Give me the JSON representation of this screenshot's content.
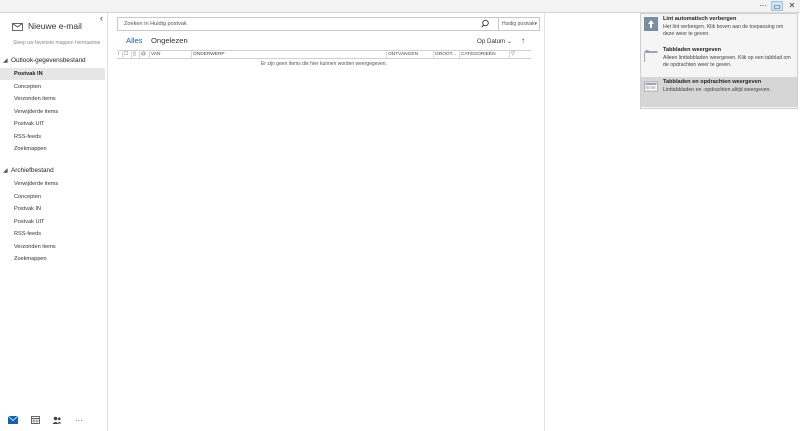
{
  "window": {
    "more_glyph": "···",
    "ribbon_options_glyph": "▭",
    "close_glyph": "✕"
  },
  "sidebar": {
    "new_mail_label": "Nieuwe e-mail",
    "collapse_glyph": "‹",
    "favorites_hint": "Sleep uw favoriete mappen hiernaartoe",
    "groups": [
      {
        "name": "Outlook-gegevensbestand",
        "folders": [
          "Postvak IN",
          "Concepten",
          "Verzonden items",
          "Verwijderde items",
          "Postvak UIT",
          "RSS-feeds",
          "Zoekmappen"
        ]
      },
      {
        "name": "Archiefbestand",
        "folders": [
          "Verwijderde items",
          "Concepten",
          "Postvak IN",
          "Postvak UIT",
          "RSS-feeds",
          "Verzonden items",
          "Zoekmappen"
        ]
      }
    ],
    "selected_folder": "Postvak IN",
    "nav": [
      "mail-icon",
      "calendar-icon",
      "people-icon",
      "more-icon"
    ],
    "nav_more_glyph": "···"
  },
  "search": {
    "placeholder": "Zoeken in Huidig postvak",
    "scope_label": "Huidig postvak",
    "scope_chevron": "▾"
  },
  "filters": {
    "all": "Alles",
    "unread": "Ongelezen"
  },
  "sort": {
    "label": "Op Datum",
    "chevron": "⌄",
    "direction_glyph": "↑"
  },
  "columns": [
    "!",
    "☐",
    "▯",
    "@",
    "VAN",
    "ONDERWERP",
    "ONTVANGEN",
    "GROOT...",
    "CATEGORIEËN",
    "▽"
  ],
  "empty_message": "Er zijn geen items die hier kunnen worden weergegeven.",
  "ribbon_menu": {
    "options": [
      {
        "title": "Lint automatisch verbergen",
        "desc": "Het lint verbergen. Klik boven aan de toepassing om deze weer te geven.",
        "icon": "auto-hide-ribbon-icon"
      },
      {
        "title": "Tabbladen weergeven",
        "desc": "Alleen linttabbladen weergeven. Klik op een tabblad om de opdrachten weer te geven.",
        "icon": "show-tabs-icon"
      },
      {
        "title": "Tabbladen en opdrachten weergeven",
        "desc": "Linttabbladen en -opdrachten altijd weergeven.",
        "icon": "show-tabs-commands-icon"
      }
    ],
    "selected": "Tabbladen en opdrachten weergeven"
  },
  "colors": {
    "accent": "#0f62b4",
    "selected_bg": "#e6e6e6",
    "menu_selected_bg": "#d6d6d6"
  }
}
